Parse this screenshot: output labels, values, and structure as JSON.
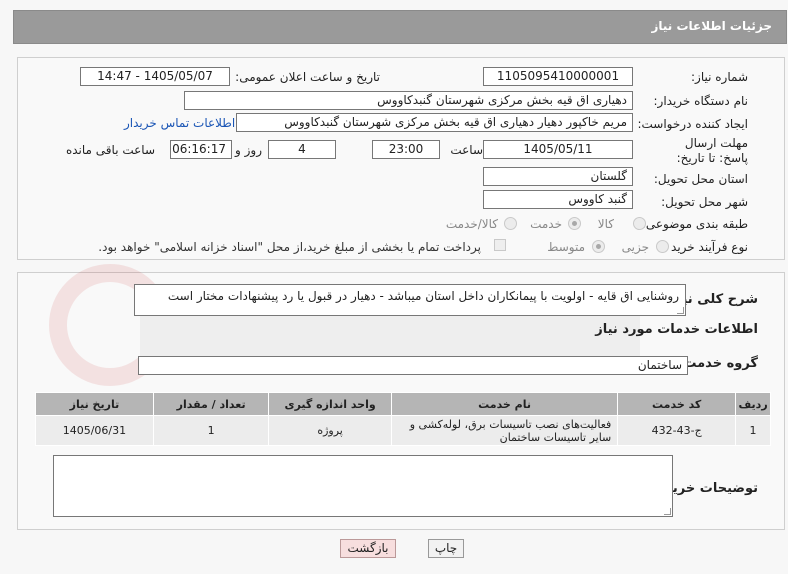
{
  "page": {
    "title": "جزئیات اطلاعات نیاز"
  },
  "fields": {
    "need_number": {
      "label": "شماره نیاز:",
      "value": "1105095410000001"
    },
    "announce_datetime": {
      "label": "تاریخ و ساعت اعلان عمومی:",
      "value": "1405/05/07 - 14:47"
    },
    "buyer_org": {
      "label": "نام دستگاه خریدار:",
      "value": "دهیاری اق قیه بخش مرکزی شهرستان گنبدکاووس"
    },
    "requester": {
      "label": "ایجاد کننده درخواست:",
      "value": "مریم خاکپور دهیار دهیاری اق قیه بخش مرکزی شهرستان گنبدکاووس"
    },
    "contact_link": "اطلاعات تماس خریدار",
    "deadline": {
      "label": "مهلت ارسال پاسخ: تا تاریخ:",
      "date": "1405/05/11",
      "time_label": "ساعت",
      "time": "23:00",
      "days": "4",
      "days_label": "روز و",
      "remaining": "06:16:17",
      "remaining_label": "ساعت باقی مانده"
    },
    "province": {
      "label": "استان محل تحویل:",
      "value": "گلستان"
    },
    "city": {
      "label": "شهر محل تحویل:",
      "value": "گنبد کاووس"
    },
    "category": {
      "label": "طبقه بندی موضوعی:",
      "options": [
        "کالا",
        "خدمت",
        "کالا/خدمت"
      ],
      "selected": "خدمت"
    },
    "purchase_type": {
      "label": "نوع فرآیند خرید :",
      "options": [
        "جزیی",
        "متوسط"
      ],
      "selected": "متوسط",
      "payment_note": "پرداخت تمام یا بخشی از مبلغ خرید،از محل \"اسناد خزانه اسلامی\" خواهد بود."
    }
  },
  "summary": {
    "label": "شرح کلی نیاز:",
    "value": "روشنایی اق قایه - اولویت با پیمانکاران داخل استان میباشد -  دهیار در قبول یا رد پیشنهادات مختار است"
  },
  "services": {
    "title": "اطلاعات خدمات مورد نیاز",
    "group_label": "گروه خدمت:",
    "group_value": "ساختمان",
    "columns": [
      "ردیف",
      "کد خدمت",
      "نام خدمت",
      "واحد اندازه گیری",
      "تعداد / مقدار",
      "تاریخ نیاز"
    ],
    "rows": [
      {
        "index": "1",
        "code": "ج-43-432",
        "name": "فعالیت‌های نصب تاسیسات برق، لوله‌کشی و سایر تاسیسات ساختمان",
        "unit": "پروژه",
        "qty": "1",
        "date": "1405/06/31"
      }
    ]
  },
  "buyer_notes": {
    "label": "توضیحات خریدار:",
    "value": ""
  },
  "buttons": {
    "print": "چاپ",
    "back": "بازگشت"
  },
  "colors": {
    "title_bar": "#9a9a9a",
    "link": "#1a55b5",
    "back_button_bg": "#f7dede"
  }
}
